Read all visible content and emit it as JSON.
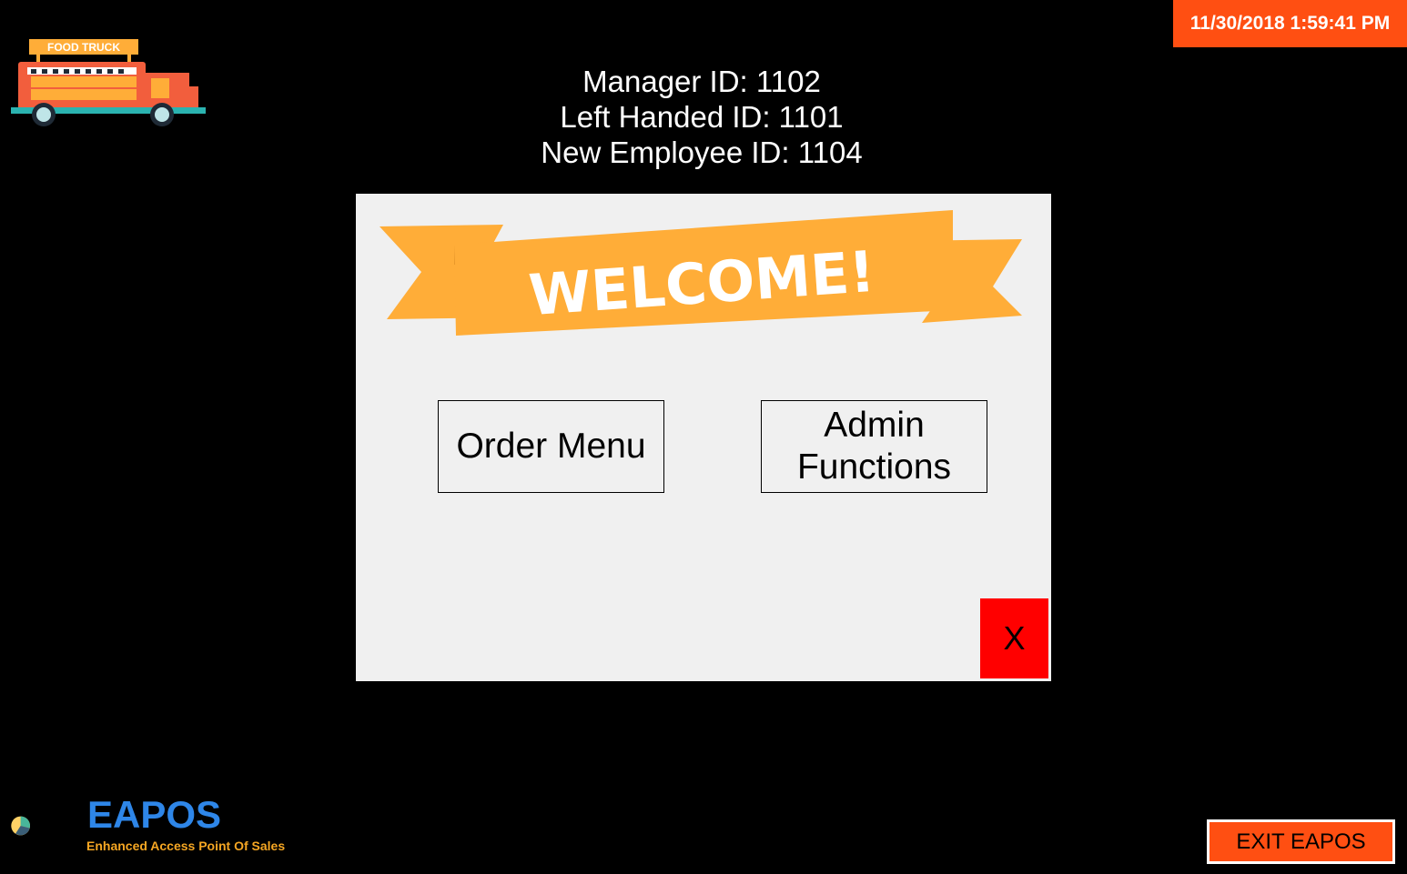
{
  "header": {
    "datetime": "11/30/2018 1:59:41 PM",
    "truck_sign": "FOOD TRUCK"
  },
  "ids": {
    "manager": "Manager ID: 1102",
    "left_handed": "Left Handed ID: 1101",
    "new_employee": "New Employee ID: 1104"
  },
  "welcome": {
    "banner": "WELCOME!",
    "order_menu": "Order Menu",
    "admin_line1": "Admin",
    "admin_line2": "Functions",
    "close": "X"
  },
  "footer": {
    "brand": "EAPOS",
    "tagline": "Enhanced Access Point Of Sales",
    "exit": "EXIT EAPOS"
  },
  "colors": {
    "accent_orange": "#ff4f12",
    "banner_orange": "#ffad38",
    "close_red": "#ff0000",
    "brand_blue": "#2e86e8"
  },
  "icons": [
    "food-truck-icon",
    "pie-chart-logo-icon"
  ]
}
